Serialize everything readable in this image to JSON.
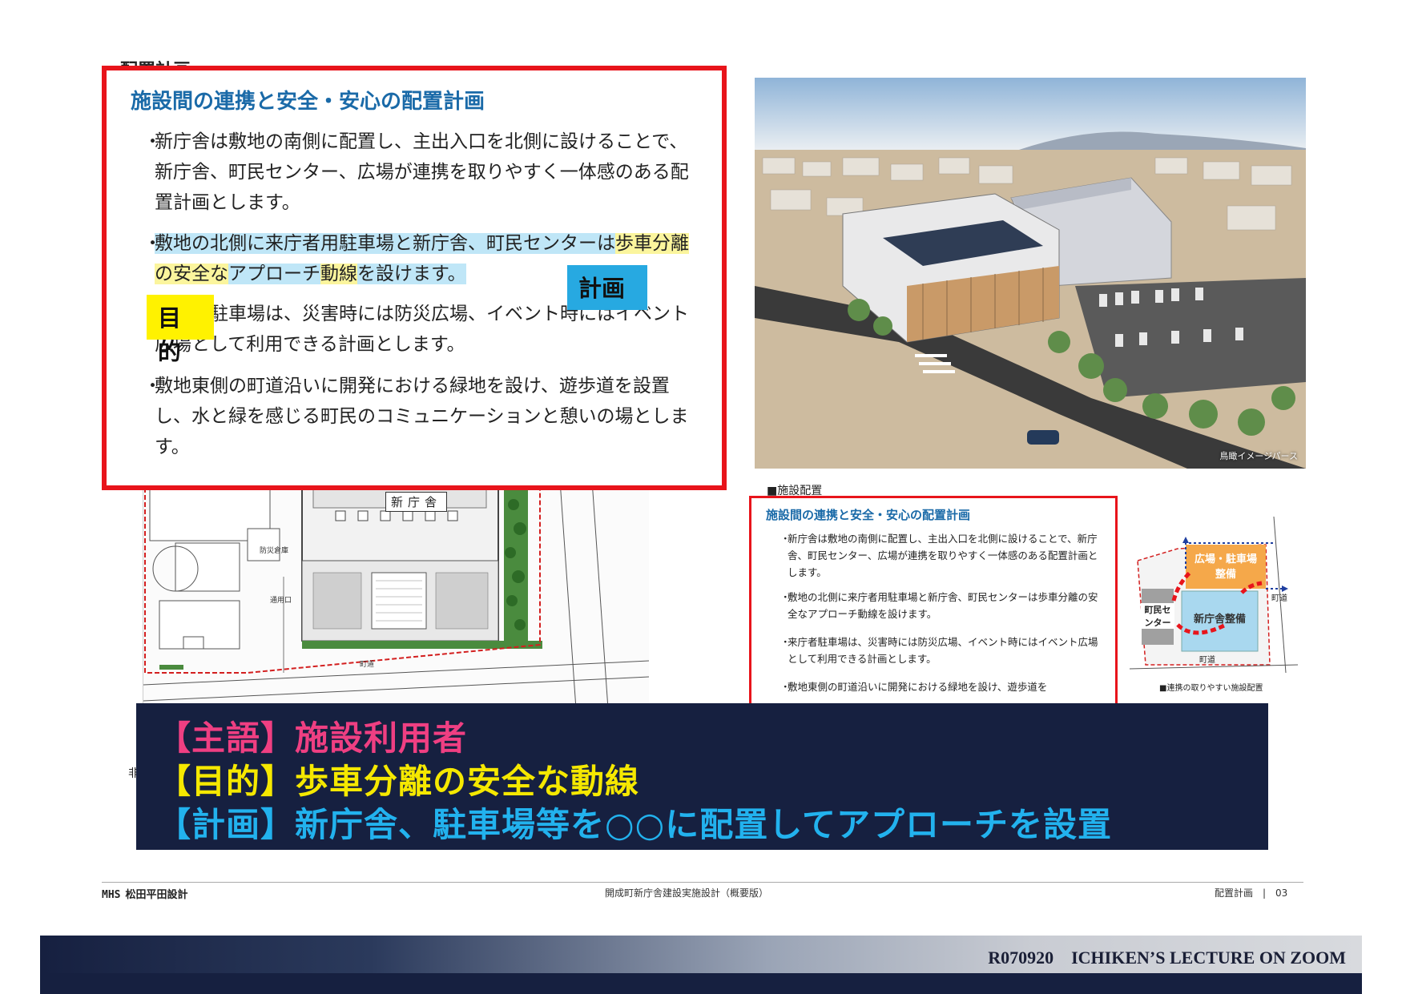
{
  "page": {
    "section_title": "配置計画",
    "section_mini": "■施設配置"
  },
  "callout": {
    "title": "施設間の連携と安全・安心の配置計画",
    "bullet1": "新庁舎は敷地の南側に配置し、主出入口を北側に設けることで、新庁舎、町民センター、広場が連携を取りやすく一体感のある配置計画とします。",
    "bullet2_parts": {
      "a": "敷地の北側に来庁者用駐車場と新庁舎、町民センターは",
      "b": "歩車分離の安全な",
      "c": "アプローチ",
      "d": "動線",
      "e": "を設けます。"
    },
    "bullet3": "来庁者駐車場は、災害時には防災広場、イベント時にはイベント広場として利用できる計画とします。",
    "bullet4": "敷地東側の町道沿いに開発における緑地を設け、遊歩道を設置し、水と緑を感じる町民のコミュニケーションと憩いの場とします。",
    "tag_purpose": "目的",
    "tag_plan": "計画",
    "bullet_dot": "・"
  },
  "render": {
    "caption": "鳥瞰イメージパース"
  },
  "siteplan": {
    "building_label": "新庁舎",
    "road_label": "町道",
    "entry_label": "通用口",
    "small1": "防災倉庫"
  },
  "minibox": {
    "title": "施設間の連携と安全・安心の配置計画",
    "bullet1": "新庁舎は敷地の南側に配置し、主出入口を北側に設けることで、新庁舎、町民センター、広場が連携を取りやすく一体感のある配置計画とします。",
    "bullet2": "敷地の北側に来庁者用駐車場と新庁舎、町民センターは歩車分離の安全なアプローチ動線を設けます。",
    "bullet3": "来庁者駐車場は、災害時には防災広場、イベント時にはイベント広場として利用できる計画とします。",
    "bullet4": "敷地東側の町道沿いに開発における緑地を設け、遊歩道を",
    "dot": "・"
  },
  "diagram": {
    "plaza": "広場・駐車場整備",
    "center": "町民センター",
    "newhall": "新庁舎整備",
    "road_top": "町道",
    "road_bottom": "町道",
    "caption": "■連携の取りやすい施設配置",
    "colors": {
      "plaza": "#f5a84a",
      "newhall": "#a9d8ef",
      "center": "#a0a0a0",
      "route": "#e8141b",
      "arrow": "#1f3fa0"
    }
  },
  "summary": {
    "line1_tag": "【主語】",
    "line1_text": "施設利用者",
    "line2_tag": "【目的】",
    "line2_text": "歩車分離の安全な動線",
    "line3_tag": "【計画】",
    "line3_text": "新庁舎、駐車場等を○○に配置してアプローチを設置"
  },
  "footer": {
    "company": "松田平田設計",
    "logo": "MHS",
    "center": "開成町新庁舎建設実施設計（概要版）",
    "right": "配置計画　|　03"
  },
  "lecture": {
    "label": "R070920　ICHIKEN’S LECTURE ON ZOOM"
  },
  "fragment": "非"
}
